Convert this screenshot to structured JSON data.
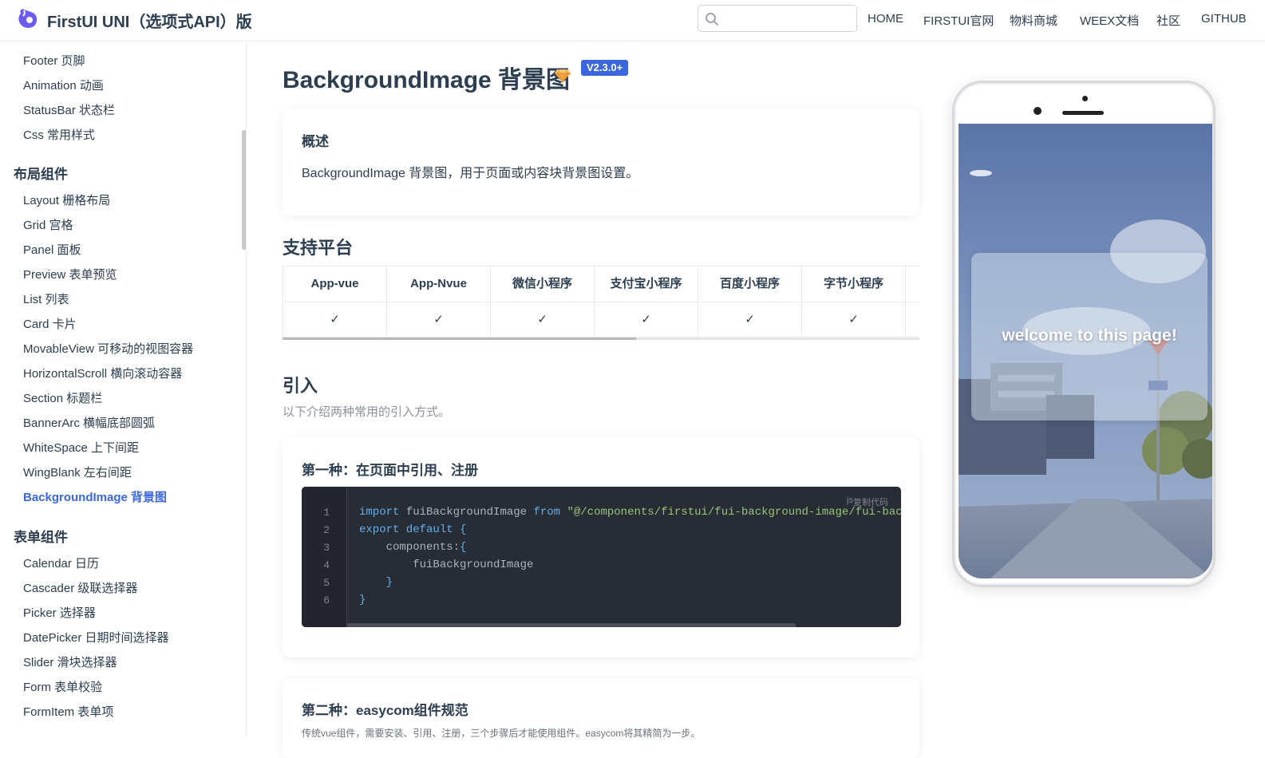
{
  "header": {
    "title": "FirstUI UNI（选项式API）版",
    "search_placeholder": "",
    "nav": [
      {
        "label": "HOME"
      },
      {
        "label": "FIRSTUI官网"
      },
      {
        "label": "物料商城"
      },
      {
        "label": "WEEX文档"
      },
      {
        "label": "社区"
      },
      {
        "label": "GITHUB"
      }
    ]
  },
  "sidebar": {
    "top_items": [
      "Footer 页脚",
      "Animation 动画",
      "StatusBar 状态栏",
      "Css 常用样式"
    ],
    "layout_group": "布局组件",
    "layout_items": [
      "Layout 栅格布局",
      "Grid 宫格",
      "Panel 面板",
      "Preview 表单预览",
      "List 列表",
      "Card 卡片",
      "MovableView 可移动的视图容器",
      "HorizontalScroll 横向滚动容器",
      "Section 标题栏",
      "BannerArc 横幅底部圆弧",
      "WhiteSpace 上下间距",
      "WingBlank 左右间距",
      "BackgroundImage 背景图"
    ],
    "form_group": "表单组件",
    "form_items": [
      "Calendar 日历",
      "Cascader 级联选择器",
      "Picker 选择器",
      "DatePicker 日期时间选择器",
      "Slider 滑块选择器",
      "Form 表单校验",
      "FormItem 表单项"
    ]
  },
  "main": {
    "title": "BackgroundImage 背景图",
    "version": "V2.3.0+",
    "overview": {
      "title": "概述",
      "text": "BackgroundImage 背景图，用于页面或内容块背景图设置。"
    },
    "platforms": {
      "title": "支持平台",
      "headers": [
        "App-vue",
        "App-Nvue",
        "微信小程序",
        "支付宝小程序",
        "百度小程序",
        "字节小程序"
      ],
      "values": [
        "✓",
        "✓",
        "✓",
        "✓",
        "✓",
        "✓"
      ]
    },
    "import": {
      "title": "引入",
      "desc": "以下介绍两种常用的引入方式。",
      "way1": {
        "title": "第一种：在页面中引用、注册",
        "lang": "js",
        "copy_label": "复制代码",
        "lines": [
          {
            "num": "1",
            "kw1": "import",
            "t1": " fuiBackgroundImage ",
            "kw2": "from",
            "t2": " ",
            "str": "\"@/components/firstui/fui-background-image/fui-backg"
          },
          {
            "num": "2",
            "kw1": "export default",
            "t1": " ",
            "kw2": "{",
            "t2": "",
            "str": ""
          },
          {
            "num": "3",
            "kw1": "",
            "t1": "    components:",
            "kw2": "{",
            "t2": "",
            "str": ""
          },
          {
            "num": "4",
            "kw1": "",
            "t1": "        fuiBackgroundImage",
            "kw2": "",
            "t2": "",
            "str": ""
          },
          {
            "num": "5",
            "kw1": "",
            "t1": "    ",
            "kw2": "}",
            "t2": "",
            "str": ""
          },
          {
            "num": "6",
            "kw1": "",
            "t1": "",
            "kw2": "}",
            "t2": "",
            "str": ""
          }
        ]
      },
      "way2": {
        "title": "第二种：easycom组件规范",
        "desc": "传统vue组件，需要安装、引用、注册，三个步骤后才能使用组件。easycom将其精简为一步。"
      }
    }
  },
  "preview": {
    "welcome_text": "welcome to this page!"
  },
  "colors": {
    "accent": "#3a67e0",
    "text": "#2c3e50",
    "code_bg": "#282c34"
  }
}
